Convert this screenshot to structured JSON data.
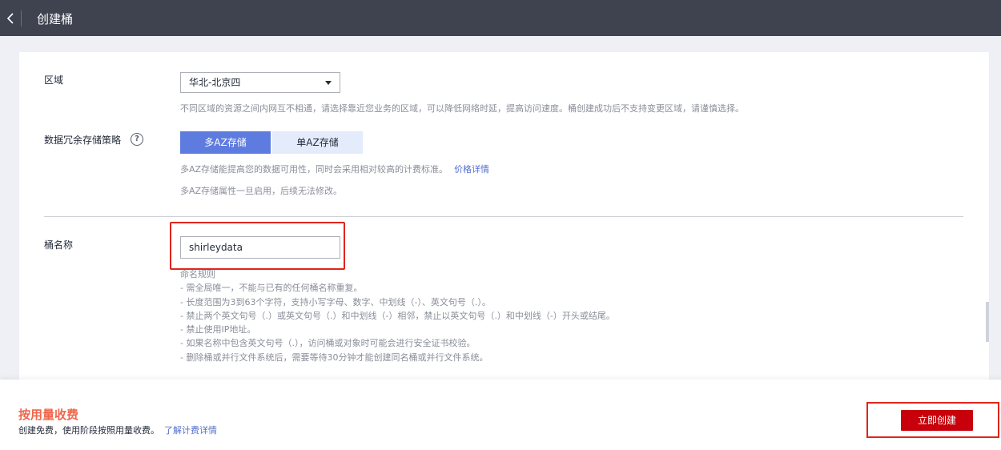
{
  "header": {
    "title": "创建桶"
  },
  "region": {
    "label": "区域",
    "value": "华北-北京四",
    "help": "不同区域的资源之间内网互不相通，请选择靠近您业务的区域，可以降低网络时延，提高访问速度。桶创建成功后不支持变更区域，请谨慎选择。"
  },
  "redundancy": {
    "label": "数据冗余存储策略",
    "options": [
      "多AZ存储",
      "单AZ存储"
    ],
    "selected": "多AZ存储",
    "help1": "多AZ存储能提高您的数据可用性，同时会采用相对较高的计费标准。",
    "help1_link": "价格详情",
    "help2": "多AZ存储属性一旦启用，后续无法修改。"
  },
  "bucket_name": {
    "label": "桶名称",
    "value": "shirleydata",
    "rules_title": "命名规则",
    "rules": [
      "- 需全局唯一，不能与已有的任何桶名称重复。",
      "- 长度范围为3到63个字符，支持小写字母、数字、中划线（-）、英文句号（.）。",
      "- 禁止两个英文句号（.）或英文句号（.）和中划线（-）相邻，禁止以英文句号（.）和中划线（-）开头或结尾。",
      "- 禁止使用IP地址。",
      "- 如果名称中包含英文句号（.），访问桶或对象时可能会进行安全证书校验。",
      "- 删除桶或并行文件系统后，需要等待30分钟才能创建同名桶或并行文件系统。"
    ]
  },
  "footer": {
    "fee_title": "按用量收费",
    "fee_desc": "创建免费，使用阶段按照用量收费。",
    "fee_link": "了解计费详情",
    "create_label": "立即创建"
  },
  "colors": {
    "primary": "#5e7ce0",
    "danger": "#c7000b",
    "highlight": "#e0241b",
    "fee": "#f0664b"
  }
}
